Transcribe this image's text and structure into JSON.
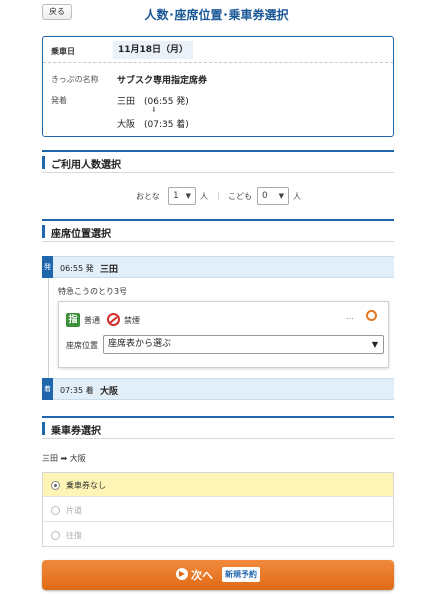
{
  "header": {
    "back_label": "戻る",
    "title": "人数･座席位置･乗車券選択"
  },
  "trip": {
    "date_label": "乗車日",
    "date_value": "11月18日（月）",
    "ticket_label": "きっぷの名称",
    "ticket_value": "サブスク専用指定席券",
    "route_label": "発着",
    "departure": "三田　(06:55 発)",
    "arrival": "大阪　(07:35 着)"
  },
  "people": {
    "section_title": "ご利用人数選択",
    "adult_label": "おとな",
    "adult_value": "1",
    "adult_unit": "人",
    "separator": "|",
    "child_label": "こども",
    "child_value": "0",
    "child_unit": "人"
  },
  "seat": {
    "section_title": "座席位置選択",
    "dep_tag": "発",
    "dep_time": "06:55 発",
    "dep_station": "三田",
    "train_name": "特急こうのとり3号",
    "reserved_icon": "指",
    "car_type": "普通",
    "smoking": "禁煙",
    "dots": "…",
    "position_label": "座席位置",
    "position_value": "座席表から選ぶ",
    "arr_tag": "着",
    "arr_time": "07:35 着",
    "arr_station": "大阪"
  },
  "ticket": {
    "section_title": "乗車券選択",
    "route": "三田 ➡ 大阪",
    "options": [
      {
        "label": "乗車券なし",
        "selected": true
      },
      {
        "label": "片道",
        "selected": false
      },
      {
        "label": "往復",
        "selected": false
      }
    ]
  },
  "footer": {
    "next_label": "次へ",
    "new_badge": "新規予約"
  },
  "colors": {
    "accent": "#1f66ad",
    "cta": "#e8741f",
    "selected_bg": "#fdf4b6"
  }
}
